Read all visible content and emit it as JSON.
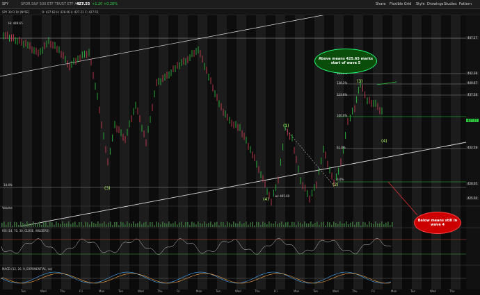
{
  "toolbar": {
    "symbol": "SPY",
    "description": "SPDR S&P 500 ETF TRUST  ETF  ARCA",
    "last_price": "427.55",
    "change": "+1.20  +0.28%",
    "right_items": [
      "Share",
      "Flexible Grid",
      "Style",
      "Drawings",
      "Studies",
      "Pattern"
    ]
  },
  "header": {
    "title": "SPY 30 D 1h [NYSE]",
    "ohlc": "O: 427.62  H: 428.06  L: 427.21  C: 427.55"
  },
  "notes": {
    "green": "Above means 425.65 marks start of wave 5",
    "red": "Below means still in wave 4"
  },
  "wave_labels": [
    "(3)",
    "(4)",
    "(1)",
    "(2)",
    "(3)",
    "(4)"
  ],
  "fib_labels": [
    "161.8%",
    "138.2%",
    "123.6%",
    "100.0%",
    "61.8%",
    "0.0%"
  ],
  "chart_tags": [
    "Hi: 449.65",
    "Lo: 405.69",
    "14.4%"
  ],
  "price_tags": [
    "447.17",
    "442.38",
    "440.67",
    "437.58",
    "432.58",
    "428.05",
    "427.55",
    "425.50"
  ],
  "x_labels": [
    "Tue",
    "Wed",
    "Thu",
    "Fri",
    "Mon",
    "Tue",
    "Wed",
    "Thu",
    "Fri",
    "Mon",
    "Tue",
    "Wed",
    "Thu",
    "Fri",
    "Mon",
    "Tue",
    "Wed",
    "Thu",
    "Fri",
    "Mon",
    "Tue",
    "Wed",
    "Thu"
  ],
  "panels": {
    "volume": "Volume",
    "rsi": "RSI (14, 70, 30, CLOSE, WILDERS)",
    "macd": "MACD (12, 26, 9, EXPONENTIAL, no)"
  },
  "colors": {
    "up": "#2ecc40",
    "down": "#e0405a",
    "note_green": "#0a4d0a",
    "note_red": "#cc0000"
  }
}
